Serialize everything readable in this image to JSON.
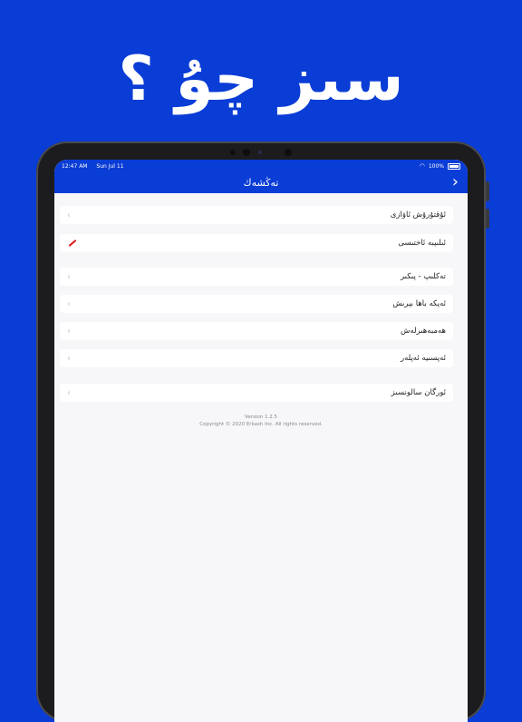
{
  "headline": "سىز چۇ ؟",
  "status_bar": {
    "time": "12:47 AM",
    "date": "Sun Jul 11",
    "battery": "100%"
  },
  "nav": {
    "title": "تەڭشەك",
    "back_icon": "chevron-right-icon"
  },
  "rows": [
    {
      "label": "ئۇقتۇرۇش ئاۋازى",
      "icon": "chevron-left-icon"
    },
    {
      "label": "ئىلىپبە ئاختىسى",
      "icon": "pencil-icon"
    },
    {
      "label": "تەكلىپ - پىكىر",
      "icon": "chevron-left-icon"
    },
    {
      "label": "ئەپكە باها بېرىش",
      "icon": "chevron-left-icon"
    },
    {
      "label": "ھەمبەھىرلەش",
      "icon": "chevron-left-icon"
    },
    {
      "label": "ئەپسىيە ئەپلەر",
      "icon": "chevron-left-icon"
    },
    {
      "label": "ئورگان سالونسىز",
      "icon": "chevron-left-icon"
    }
  ],
  "footer": {
    "version": "Version 1.2.5",
    "copyright": "Copyright © 2020 Erkash Inc. All rights reserved."
  },
  "colors": {
    "brand_blue": "#0a3cd6",
    "accent_red": "#e02020"
  }
}
